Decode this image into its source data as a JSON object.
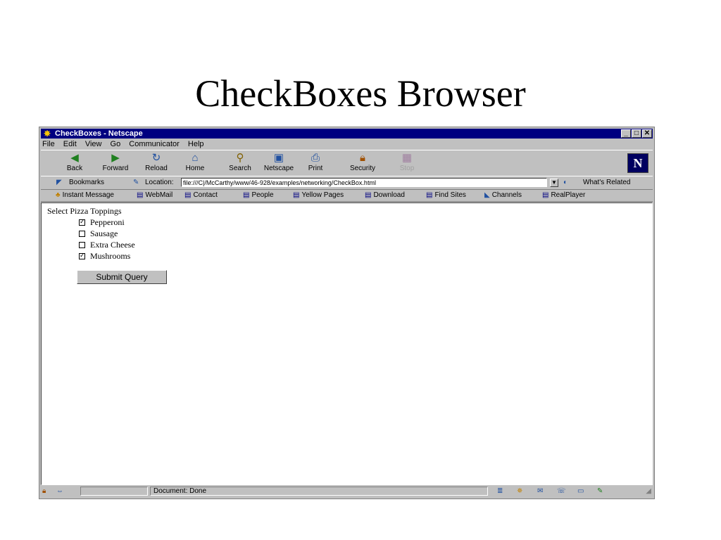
{
  "slide": {
    "title": "CheckBoxes Browser"
  },
  "window": {
    "title": "CheckBoxes - Netscape",
    "controls": [
      "_",
      "□",
      "✕"
    ]
  },
  "menu": [
    "File",
    "Edit",
    "View",
    "Go",
    "Communicator",
    "Help"
  ],
  "toolbar": {
    "buttons": [
      {
        "label": "Back",
        "icon": "back-arrow-icon"
      },
      {
        "label": "Forward",
        "icon": "forward-arrow-icon"
      },
      {
        "label": "Reload",
        "icon": "reload-icon"
      },
      {
        "label": "Home",
        "icon": "home-icon"
      },
      {
        "label": "Search",
        "icon": "search-icon"
      },
      {
        "label": "Netscape",
        "icon": "netscape-icon"
      },
      {
        "label": "Print",
        "icon": "print-icon"
      },
      {
        "label": "Security",
        "icon": "lock-icon"
      },
      {
        "label": "Stop",
        "icon": "stop-icon"
      }
    ],
    "logo": "N"
  },
  "location": {
    "bookmarks_label": "Bookmarks",
    "location_label": "Location:",
    "url": "file:///C|/McCarthy/www/46-928/examples/networking/CheckBox.html",
    "related_label": "What's Related"
  },
  "links": [
    "Instant Message",
    "WebMail",
    "Contact",
    "People",
    "Yellow Pages",
    "Download",
    "Find Sites",
    "Channels",
    "RealPlayer"
  ],
  "form": {
    "prompt": "Select Pizza Toppings",
    "toppings": [
      {
        "label": "Pepperoni",
        "checked": true
      },
      {
        "label": "Sausage",
        "checked": false
      },
      {
        "label": "Extra Cheese",
        "checked": false
      },
      {
        "label": "Mushrooms",
        "checked": true
      }
    ],
    "submit_label": "Submit Query"
  },
  "status": {
    "text": "Document: Done"
  },
  "colors": {
    "titlebar": "#000080",
    "chrome": "#c0c0c0"
  }
}
